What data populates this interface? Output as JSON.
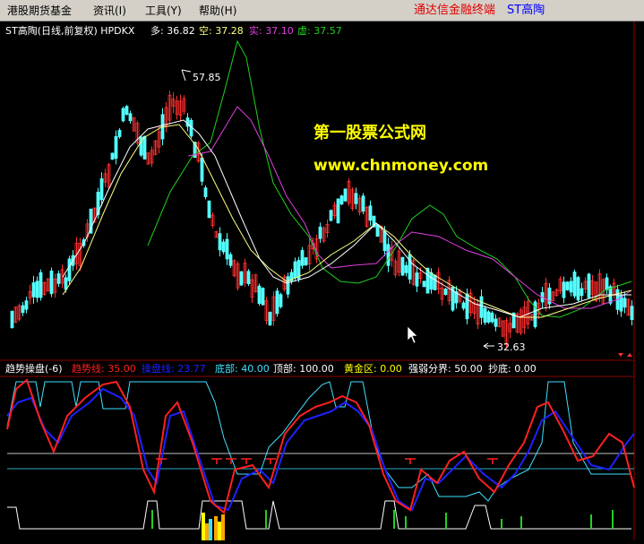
{
  "menu": {
    "items": [
      "港股期货基金",
      "资讯(I)",
      "工具(Y)",
      "帮助(H)"
    ],
    "brand": "通达信金融终端",
    "stock": "ST高陶"
  },
  "colors": {
    "background": "#000000",
    "menu_bg": "#d4d0c8",
    "brand_red": "#e00000",
    "stock_blue": "#0000ff",
    "up_candle": "#ff3030",
    "down_candle": "#54ffff",
    "ma_white": "#ffffff",
    "ma_yellow": "#ffff80",
    "band_green": "#20d020",
    "band_magenta": "#e040e0",
    "trend_red": "#ff2020",
    "operate_blue": "#2020ff",
    "cyan_line": "#40e0ff",
    "watermark": "#ffff00"
  },
  "price_panel": {
    "title": "ST高陶(日线,前复权) HPDKX",
    "legend": [
      {
        "label": "多: 36.82",
        "color": "#ffffff"
      },
      {
        "label": "空: 37.28",
        "color": "#ffff80"
      },
      {
        "label": "实: 37.10",
        "color": "#e040e0"
      },
      {
        "label": "虚: 37.57",
        "color": "#20d020"
      }
    ],
    "high_marker": "57.85",
    "low_marker": "32.63",
    "watermark_cn": "第一股票公式网",
    "watermark_url": "www.chnmoney.com"
  },
  "indicator_panel": {
    "title": "趋势操盘(-6)",
    "legend": [
      {
        "label": "趋势线: 35.00",
        "color": "#ff2020"
      },
      {
        "label": "操盘线: 23.77",
        "color": "#2020ff"
      },
      {
        "label": "底部: 40.00",
        "color": "#40e0ff"
      },
      {
        "label": "顶部: 100.00",
        "color": "#ffffff"
      },
      {
        "label": "黄金区: 0.00",
        "color": "#ffff00"
      },
      {
        "label": "强弱分界: 50.00",
        "color": "#ffffff"
      },
      {
        "label": "抄底: 0.00",
        "color": "#ffffff"
      }
    ]
  }
}
